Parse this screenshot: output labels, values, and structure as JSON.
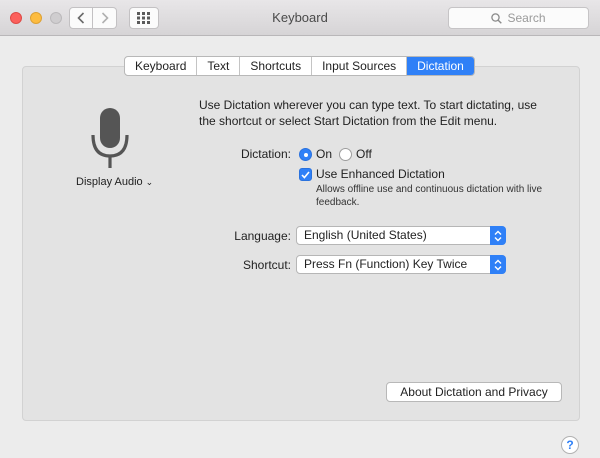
{
  "window": {
    "title": "Keyboard",
    "search_placeholder": "Search"
  },
  "tabs": [
    {
      "label": "Keyboard",
      "active": false
    },
    {
      "label": "Text",
      "active": false
    },
    {
      "label": "Shortcuts",
      "active": false
    },
    {
      "label": "Input Sources",
      "active": false
    },
    {
      "label": "Dictation",
      "active": true
    }
  ],
  "mic": {
    "icon": "microphone-icon",
    "source_label": "Display Audio"
  },
  "intro_text": "Use Dictation wherever you can type text. To start dictating, use the shortcut or select Start Dictation from the Edit menu.",
  "dictation": {
    "label": "Dictation:",
    "on_label": "On",
    "off_label": "Off",
    "selected": "On"
  },
  "enhanced": {
    "label": "Use Enhanced Dictation",
    "checked": true,
    "description": "Allows offline use and continuous dictation with live feedback."
  },
  "language": {
    "label": "Language:",
    "value": "English (United States)"
  },
  "shortcut": {
    "label": "Shortcut:",
    "value": "Press Fn (Function) Key Twice"
  },
  "about_button": "About Dictation and Privacy",
  "help_button": "?",
  "colors": {
    "accent": "#2f80f7",
    "close": "#fc605c",
    "minimize": "#fdbc40"
  }
}
